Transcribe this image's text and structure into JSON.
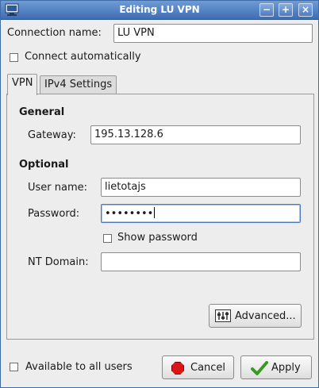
{
  "window": {
    "title": "Editing LU VPN"
  },
  "connection": {
    "name_label": "Connection name:",
    "name_value": "LU VPN",
    "auto_connect_label": "Connect automatically",
    "auto_connect_checked": false
  },
  "tabs": [
    {
      "label": "VPN",
      "active": true
    },
    {
      "label": "IPv4 Settings",
      "active": false
    }
  ],
  "general": {
    "heading": "General",
    "gateway_label": "Gateway:",
    "gateway_value": "195.13.128.6"
  },
  "optional": {
    "heading": "Optional",
    "username_label": "User name:",
    "username_value": "lietotajs",
    "password_label": "Password:",
    "password_value": "••••••••",
    "show_password_label": "Show password",
    "show_password_checked": false,
    "nt_domain_label": "NT Domain:",
    "nt_domain_value": ""
  },
  "advanced_button": {
    "label": "Advanced..."
  },
  "footer": {
    "all_users_label": "Available to all users",
    "all_users_checked": false,
    "cancel_label": "Cancel",
    "apply_label": "Apply"
  },
  "colors": {
    "titlebar": "#3f6db3",
    "focus": "#4a78c2",
    "cancel_icon": "#d81818",
    "apply_icon": "#3a9a1e"
  },
  "icons": {
    "window": "network-connection-icon",
    "minimize": "minimize-icon",
    "maximize": "maximize-icon",
    "close": "close-icon",
    "advanced": "properties-icon",
    "cancel": "stop-icon",
    "apply": "checkmark-icon"
  }
}
